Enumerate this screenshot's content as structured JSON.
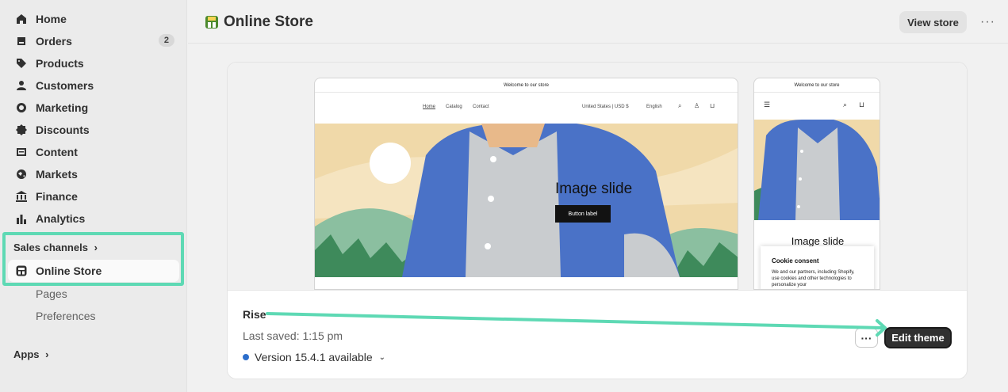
{
  "sidebar": {
    "items": [
      {
        "label": "Home",
        "icon": "home-icon"
      },
      {
        "label": "Orders",
        "icon": "orders-icon",
        "badge": "2"
      },
      {
        "label": "Products",
        "icon": "tag-icon"
      },
      {
        "label": "Customers",
        "icon": "person-icon"
      },
      {
        "label": "Marketing",
        "icon": "target-icon"
      },
      {
        "label": "Discounts",
        "icon": "discount-icon"
      },
      {
        "label": "Content",
        "icon": "content-icon"
      },
      {
        "label": "Markets",
        "icon": "globe-icon"
      },
      {
        "label": "Finance",
        "icon": "bank-icon"
      },
      {
        "label": "Analytics",
        "icon": "chart-icon"
      }
    ],
    "sales_channels_label": "Sales channels",
    "online_store_label": "Online Store",
    "sub_items": [
      "Pages",
      "Preferences"
    ],
    "apps_label": "Apps"
  },
  "header": {
    "title": "Online Store",
    "view_store_label": "View store",
    "more_label": "···"
  },
  "preview": {
    "welcome_text": "Welcome to our store",
    "nav_links": [
      "Home",
      "Catalog",
      "Contact"
    ],
    "locale": "United States | USD $",
    "language": "English",
    "hero_heading": "Image slide",
    "hero_button": "Button label",
    "mobile_heading": "Image slide",
    "cookie_title": "Cookie consent",
    "cookie_text": "We and our partners, including Shopify, use cookies and other technologies to personalize your"
  },
  "theme": {
    "name": "Rise",
    "last_saved": "Last saved: 1:15 pm",
    "version": "Version 15.4.1 available",
    "more_label": "···",
    "edit_label": "Edit theme"
  },
  "colors": {
    "highlight": "#5ed9b4",
    "accent_dot": "#2c6ecb",
    "primary_button": "#303030"
  }
}
